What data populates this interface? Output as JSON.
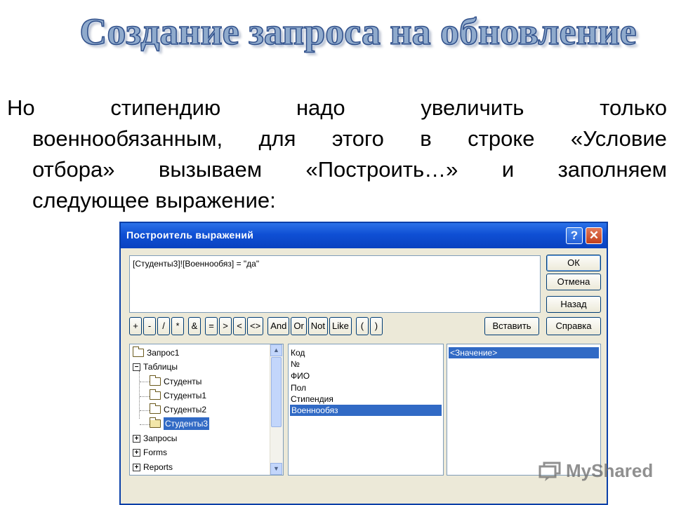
{
  "slide": {
    "title": "Создание запроса на обновление",
    "paragraph": [
      [
        "Но",
        "стипендию",
        "надо",
        "увеличить",
        "только"
      ],
      [
        "военнообязанным,",
        "для",
        "этого",
        "в",
        "строке",
        "«Условие"
      ],
      [
        "отбора»",
        "вызываем",
        "«Построить…»",
        "и",
        "заполняем"
      ],
      [
        "следующее выражение:"
      ]
    ]
  },
  "dialog": {
    "title": "Построитель выражений",
    "help_label": "?",
    "close_label": "✕",
    "expression": "[Студенты3]![Военнообяз] = \"да\"",
    "buttons": {
      "ok": "ОК",
      "cancel": "Отмена",
      "back": "Назад",
      "insert": "Вставить",
      "help": "Справка"
    },
    "operators": [
      "+",
      "-",
      "/",
      "*",
      "&",
      "=",
      ">",
      "<",
      "<>",
      "And",
      "Or",
      "Not",
      "Like",
      "(",
      ")"
    ],
    "tree": {
      "items": [
        {
          "label": "Запрос1",
          "icon": "folder-icon"
        },
        {
          "label": "Таблицы",
          "icon": "folder-icon",
          "toggle": "−"
        },
        {
          "label": "Студенты",
          "icon": "folder-icon"
        },
        {
          "label": "Студенты1",
          "icon": "folder-icon"
        },
        {
          "label": "Студенты2",
          "icon": "folder-icon"
        },
        {
          "label": "Студенты3",
          "icon": "open-folder-icon",
          "selected": true
        },
        {
          "label": "Запросы",
          "icon": "folder-icon",
          "toggle": "+"
        },
        {
          "label": "Forms",
          "icon": "folder-icon",
          "toggle": "+"
        },
        {
          "label": "Reports",
          "icon": "folder-icon",
          "toggle": "+"
        }
      ]
    },
    "fields": {
      "items": [
        "Код",
        "№",
        "ФИО",
        "Пол",
        "Стипендия",
        "Военнообяз"
      ],
      "selected": "Военнообяз"
    },
    "values": {
      "items": [
        "<Значение>"
      ],
      "selected": "<Значение>"
    }
  },
  "watermark": {
    "text": "MyShared",
    "icon": "myshared-logo-icon"
  },
  "colors": {
    "titlebar": "#0f4fd4",
    "selection": "#316ac5",
    "dialog_bg": "#ece9d8",
    "title_text": "#8faacc"
  }
}
